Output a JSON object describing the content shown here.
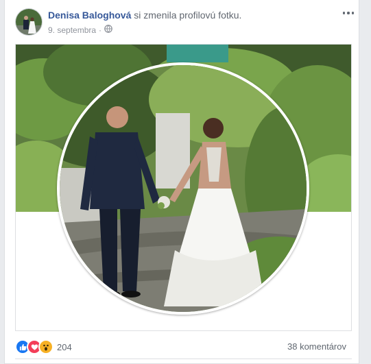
{
  "post": {
    "author": "Denisa Baloghová",
    "action": " si zmenila profilovú fotku.",
    "date": "9. septembra",
    "separator": "·",
    "privacy_icon": "globe-icon",
    "more_icon": "more-dots-icon"
  },
  "reactions": {
    "icons": [
      "like-icon",
      "love-icon",
      "wow-icon"
    ],
    "count": "204"
  },
  "comments": {
    "label": "38 komentárov"
  },
  "colors": {
    "author": "#365899",
    "like": "#1877f2",
    "love": "#f33e58",
    "wow": "#f7b125",
    "meta": "#90949c"
  }
}
